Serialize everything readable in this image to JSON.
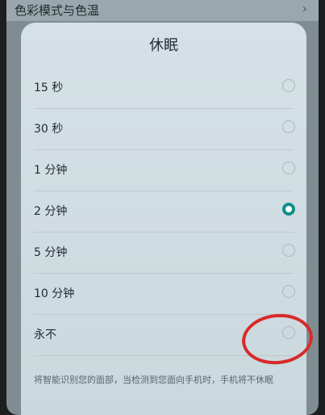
{
  "background": {
    "row_label": "色彩模式与色温",
    "chevron": "›"
  },
  "dialog": {
    "title": "休眠",
    "options": [
      {
        "label": "15 秒",
        "selected": false
      },
      {
        "label": "30 秒",
        "selected": false
      },
      {
        "label": "1 分钟",
        "selected": false
      },
      {
        "label": "2 分钟",
        "selected": true
      },
      {
        "label": "5 分钟",
        "selected": false
      },
      {
        "label": "10 分钟",
        "selected": false
      },
      {
        "label": "永不",
        "selected": false
      }
    ],
    "note": "将智能识别您的面部，当检测到您面向手机时，手机将不休眠"
  },
  "colors": {
    "accent": "#0f8f8c",
    "annotation": "#d82a2a"
  }
}
